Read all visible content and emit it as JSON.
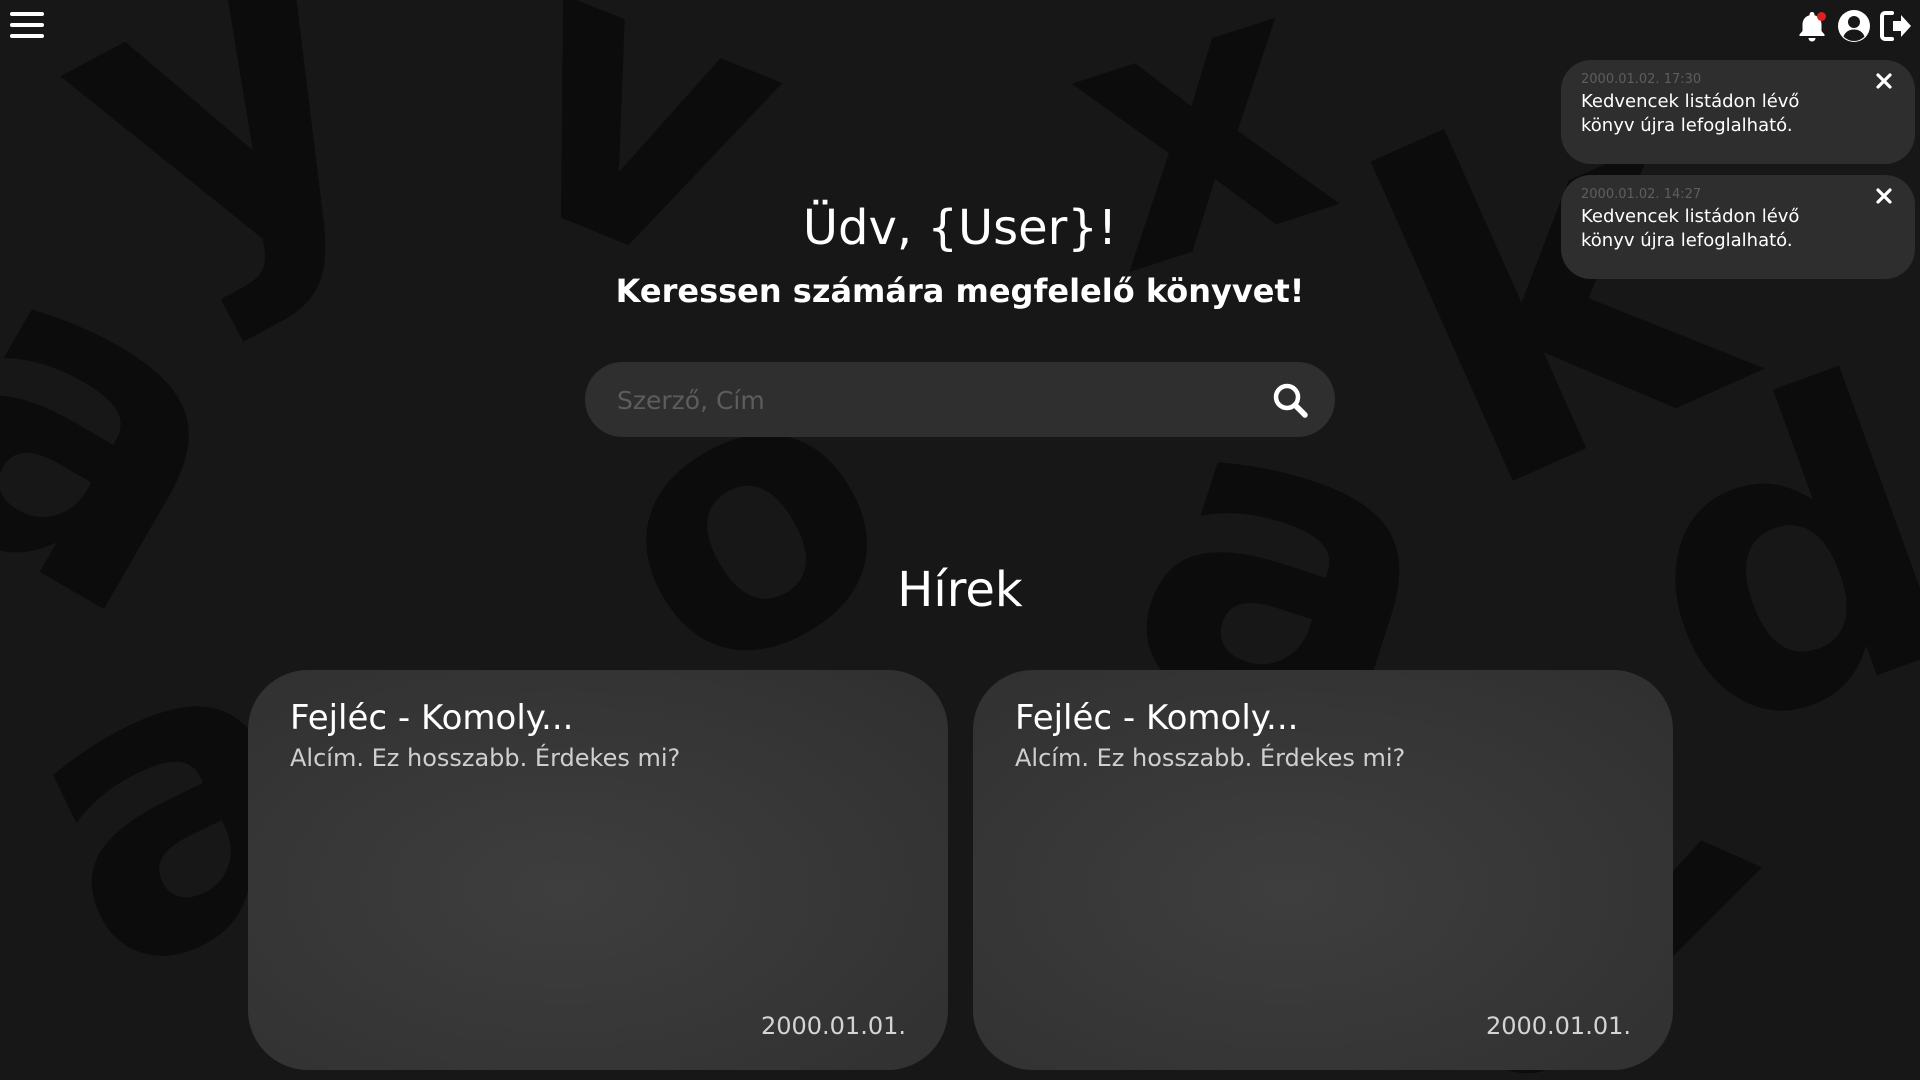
{
  "header": {
    "menu_icon": "hamburger-menu-icon",
    "icons": [
      "bell-icon",
      "user-circle-icon",
      "logout-icon"
    ]
  },
  "notifications": [
    {
      "time": "2000.01.02. 17:30",
      "text": "Kedvencek listádon lévő könyv újra lefoglalható."
    },
    {
      "time": "2000.01.02. 14:27",
      "text": "Kedvencek listádon lévő könyv újra lefoglalható."
    }
  ],
  "hero": {
    "greeting": "Üdv, {User}!",
    "subtitle": "Keressen számára megfelelő könyvet!"
  },
  "search": {
    "placeholder": "Szerző, Cím",
    "value": ""
  },
  "news": {
    "title": "Hírek",
    "items": [
      {
        "title": "Fejléc - Komoly...",
        "subtitle": "Alcím. Ez hosszabb. Érdekes mi?",
        "date": "2000.01.01."
      },
      {
        "title": "Fejléc - Komoly...",
        "subtitle": "Alcím. Ez hosszabb. Érdekes mi?",
        "date": "2000.01.01."
      }
    ]
  },
  "colors": {
    "background": "#171717",
    "surface": "#2f2f2f",
    "card": "#383838",
    "notification_dot": "#e02020",
    "text": "#ffffff",
    "muted_text": "#5d5d5d"
  }
}
